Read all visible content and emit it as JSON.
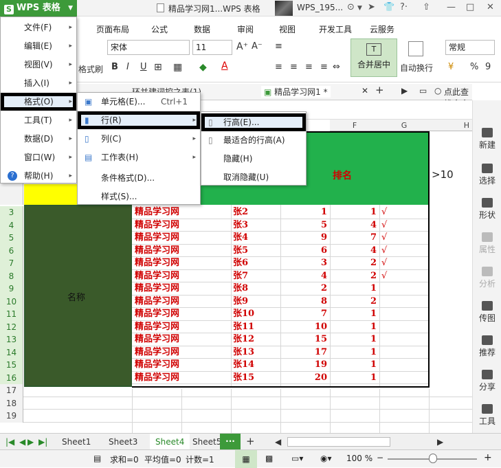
{
  "app": {
    "brand": "WPS 表格",
    "window_title": "精品学习网1...WPS 表格",
    "user": "WPS_195..."
  },
  "ribbon_tabs": [
    "页面布局",
    "公式",
    "数据",
    "审阅",
    "视图",
    "开发工具",
    "云服务"
  ],
  "ribbon": {
    "font_name": "宋体",
    "font_size": "11",
    "bold": "B",
    "italic": "I",
    "underline": "U",
    "merge_label": "合并居中",
    "wrap_label": "自动换行",
    "format_label": "常规",
    "percent": "%",
    "comma": "9",
    "painter_label": "格式刷"
  },
  "doc_tabs": {
    "tab1": "环并建词控之表(1)",
    "tab2": "精品学习网1 *",
    "add": "+",
    "search": "点此查找命令"
  },
  "main_menu": [
    {
      "label": "文件(F)"
    },
    {
      "label": "编辑(E)"
    },
    {
      "label": "视图(V)"
    },
    {
      "label": "插入(I)"
    },
    {
      "label": "格式(O)"
    },
    {
      "label": "工具(T)"
    },
    {
      "label": "数据(D)"
    },
    {
      "label": "窗口(W)"
    },
    {
      "label": "帮助(H)"
    }
  ],
  "format_menu": [
    {
      "label": "单元格(E)...",
      "shortcut": "Ctrl+1"
    },
    {
      "label": "行(R)"
    },
    {
      "label": "列(C)"
    },
    {
      "label": "工作表(H)"
    },
    {
      "label": "条件格式(D)..."
    },
    {
      "label": "样式(S)..."
    }
  ],
  "row_menu": [
    {
      "label": "行高(E)..."
    },
    {
      "label": "最适合的行高(A)"
    },
    {
      "label": "隐藏(H)"
    },
    {
      "label": "取消隐藏(U)"
    }
  ],
  "columns": [
    "F",
    "G",
    "H"
  ],
  "header_cells": {
    "rank": "排名",
    "gt10": ">10",
    "name_label": "名称"
  },
  "rows": [
    {
      "r": "3",
      "site": "精品学习网",
      "name": "张2",
      "score": "1",
      "rank": "1",
      "check": "√"
    },
    {
      "r": "4",
      "site": "精品学习网",
      "name": "张3",
      "score": "5",
      "rank": "4",
      "check": "√"
    },
    {
      "r": "5",
      "site": "精品学习网",
      "name": "张4",
      "score": "9",
      "rank": "7",
      "check": "√"
    },
    {
      "r": "6",
      "site": "精品学习网",
      "name": "张5",
      "score": "6",
      "rank": "4",
      "check": "√"
    },
    {
      "r": "7",
      "site": "精品学习网",
      "name": "张6",
      "score": "3",
      "rank": "2",
      "check": "√"
    },
    {
      "r": "8",
      "site": "精品学习网",
      "name": "张7",
      "score": "4",
      "rank": "2",
      "check": "√"
    },
    {
      "r": "9",
      "site": "精品学习网",
      "name": "张8",
      "score": "2",
      "rank": "1",
      "check": ""
    },
    {
      "r": "10",
      "site": "精品学习网",
      "name": "张9",
      "score": "8",
      "rank": "2",
      "check": ""
    },
    {
      "r": "11",
      "site": "精品学习网",
      "name": "张10",
      "score": "7",
      "rank": "1",
      "check": ""
    },
    {
      "r": "12",
      "site": "精品学习网",
      "name": "张11",
      "score": "10",
      "rank": "1",
      "check": ""
    },
    {
      "r": "13",
      "site": "精品学习网",
      "name": "张12",
      "score": "15",
      "rank": "1",
      "check": ""
    },
    {
      "r": "14",
      "site": "精品学习网",
      "name": "张13",
      "score": "17",
      "rank": "1",
      "check": ""
    },
    {
      "r": "15",
      "site": "精品学习网",
      "name": "张14",
      "score": "19",
      "rank": "1",
      "check": ""
    },
    {
      "r": "16",
      "site": "精品学习网",
      "name": "张15",
      "score": "20",
      "rank": "1",
      "check": ""
    }
  ],
  "empty_rows": [
    "17",
    "18",
    "19"
  ],
  "sheets": [
    "Sheet1",
    "Sheet3",
    "Sheet4",
    "Sheet5"
  ],
  "active_sheet": "Sheet4",
  "status": {
    "sum": "求和=0",
    "avg": "平均值=0",
    "count": "计数=1",
    "zoom": "100 %"
  },
  "right_panel": [
    "新建",
    "选择",
    "形状",
    "属性",
    "分析",
    "传图",
    "推荐",
    "分享",
    "工具"
  ],
  "colors": {
    "green": "#3d9a3a",
    "header_green": "#22b14c",
    "dark_green": "#3a5a2a",
    "yellow": "#ffff00",
    "red": "#d00000"
  }
}
